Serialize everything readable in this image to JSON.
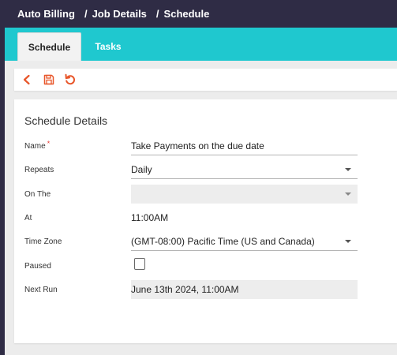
{
  "breadcrumb": {
    "items": [
      "Auto Billing",
      "Job Details",
      "Schedule"
    ],
    "separator": "/"
  },
  "tabs": [
    {
      "label": "Schedule",
      "active": true
    },
    {
      "label": "Tasks",
      "active": false
    }
  ],
  "toolbar": {
    "icons": [
      "back-icon",
      "save-icon",
      "reset-icon"
    ],
    "accent": "#e8562a"
  },
  "panel": {
    "title": "Schedule Details",
    "fields": {
      "name": {
        "label": "Name",
        "required_mark": "*",
        "value": "Take Payments on the due date"
      },
      "repeats": {
        "label": "Repeats",
        "value": "Daily"
      },
      "on_the": {
        "label": "On The",
        "value": ""
      },
      "at": {
        "label": "At",
        "value": "11:00AM"
      },
      "time_zone": {
        "label": "Time Zone",
        "value": "(GMT-08:00) Pacific Time (US and Canada)"
      },
      "paused": {
        "label": "Paused",
        "checked": false
      },
      "next_run": {
        "label": "Next Run",
        "value": "June 13th 2024, 11:00AM"
      }
    }
  },
  "colors": {
    "topbar": "#2f2c45",
    "tabbar": "#1fc8cf",
    "required": "#e53935"
  }
}
